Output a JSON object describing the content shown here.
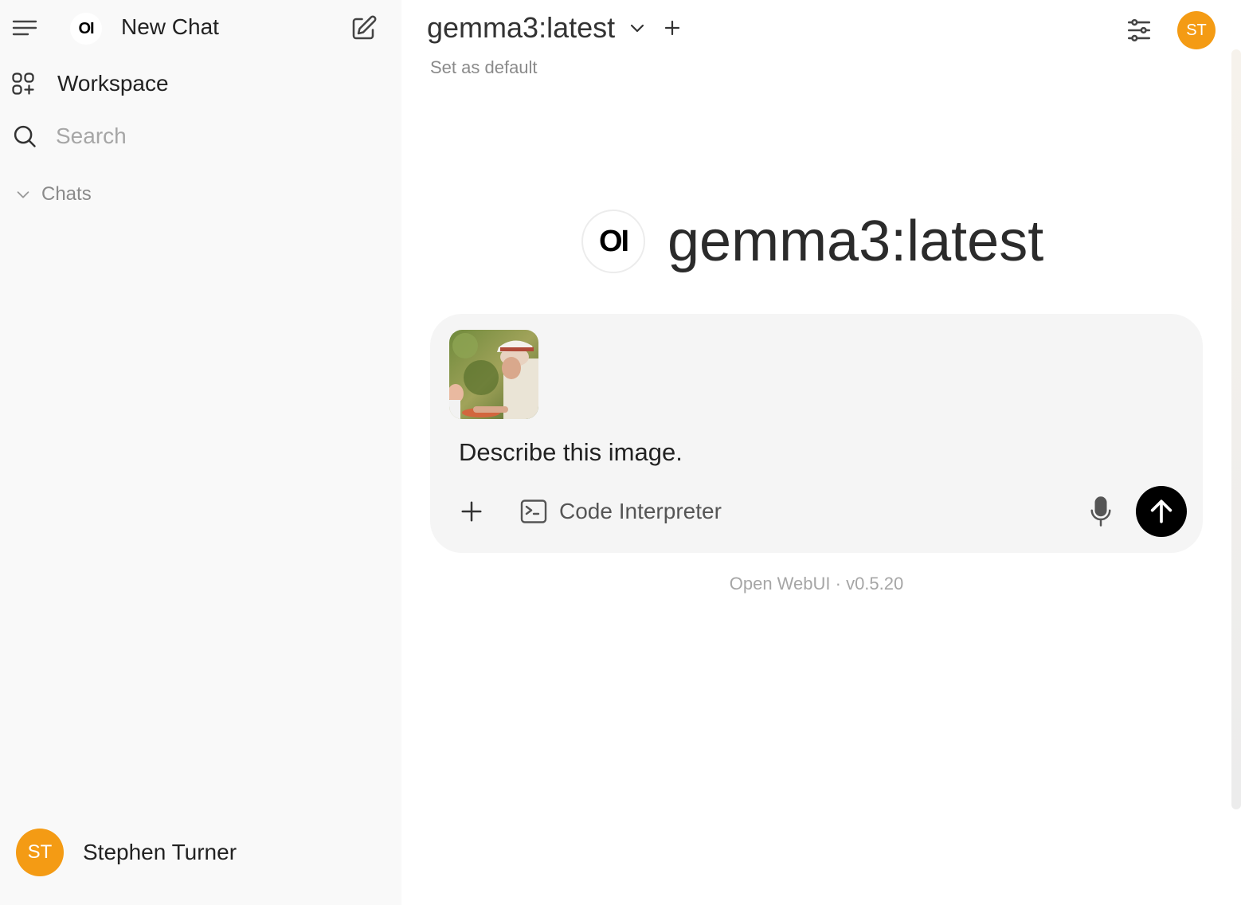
{
  "sidebar": {
    "logo_text": "OI",
    "new_chat_label": "New Chat",
    "workspace_label": "Workspace",
    "search_placeholder": "Search",
    "chats_label": "Chats",
    "user": {
      "initials": "ST",
      "name": "Stephen Turner"
    }
  },
  "header": {
    "model_name": "gemma3:latest",
    "set_default_label": "Set as default",
    "avatar_initials": "ST"
  },
  "hero": {
    "logo_text": "OI",
    "model_name": "gemma3:latest"
  },
  "composer": {
    "prompt_text": "Describe this image.",
    "code_interpreter_label": "Code Interpreter"
  },
  "footer": {
    "version_text": "Open WebUI · v0.5.20"
  },
  "colors": {
    "accent_avatar": "#f49b14",
    "sidebar_bg": "#f9f9f9",
    "composer_bg": "#f5f5f5",
    "send_button": "#000000"
  },
  "icons": [
    "menu-icon",
    "edit-icon",
    "workspace-icon",
    "search-icon",
    "chevron-down-icon",
    "plus-icon",
    "sliders-icon",
    "terminal-icon",
    "microphone-icon",
    "arrow-up-icon"
  ]
}
